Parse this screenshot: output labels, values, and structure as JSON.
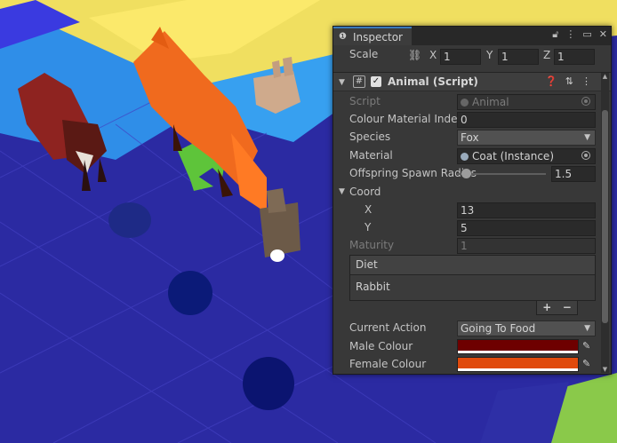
{
  "inspector": {
    "tab_label": "Inspector",
    "scale": {
      "label": "Scale",
      "x_label": "X",
      "x": "1",
      "y_label": "Y",
      "y": "1",
      "z_label": "Z",
      "z": "1"
    },
    "component": {
      "title": "Animal (Script)",
      "enabled": true,
      "fields": {
        "script": {
          "label": "Script",
          "value": "Animal"
        },
        "colour_material_index": {
          "label": "Colour Material Index",
          "value": "0"
        },
        "species": {
          "label": "Species",
          "value": "Fox"
        },
        "material": {
          "label": "Material",
          "value": "Coat (Instance)"
        },
        "offspring_spawn_radius": {
          "label": "Offspring Spawn Radius",
          "value": "1.5"
        },
        "coord": {
          "label": "Coord",
          "x_label": "X",
          "x": "13",
          "y_label": "Y",
          "y": "5"
        },
        "maturity": {
          "label": "Maturity",
          "value": "1"
        },
        "diet": {
          "label": "Diet",
          "items": [
            "Rabbit"
          ],
          "add": "+",
          "remove": "−"
        },
        "current_action": {
          "label": "Current Action",
          "value": "Going To Food"
        },
        "male_colour": {
          "label": "Male Colour",
          "color": "#6e0000"
        },
        "female_colour": {
          "label": "Female Colour",
          "color": "#e04a0c"
        }
      }
    }
  },
  "icons": [
    "info-icon",
    "unlink-icon",
    "lock-icon",
    "kebab-icon",
    "maximize-icon",
    "close-icon",
    "script-icon",
    "help-icon",
    "presets-icon",
    "object-picker-icon",
    "eyedropper-icon"
  ],
  "colors": {
    "panel_bg": "#383838",
    "tab_accent": "#3a79bb",
    "scene_blue": "#2e2fa6",
    "scene_yellow": "#f1df5e",
    "fox_orange": "#f26a1f",
    "fox_red": "#9a2a22",
    "rabbit_brown": "#6c5a48"
  }
}
